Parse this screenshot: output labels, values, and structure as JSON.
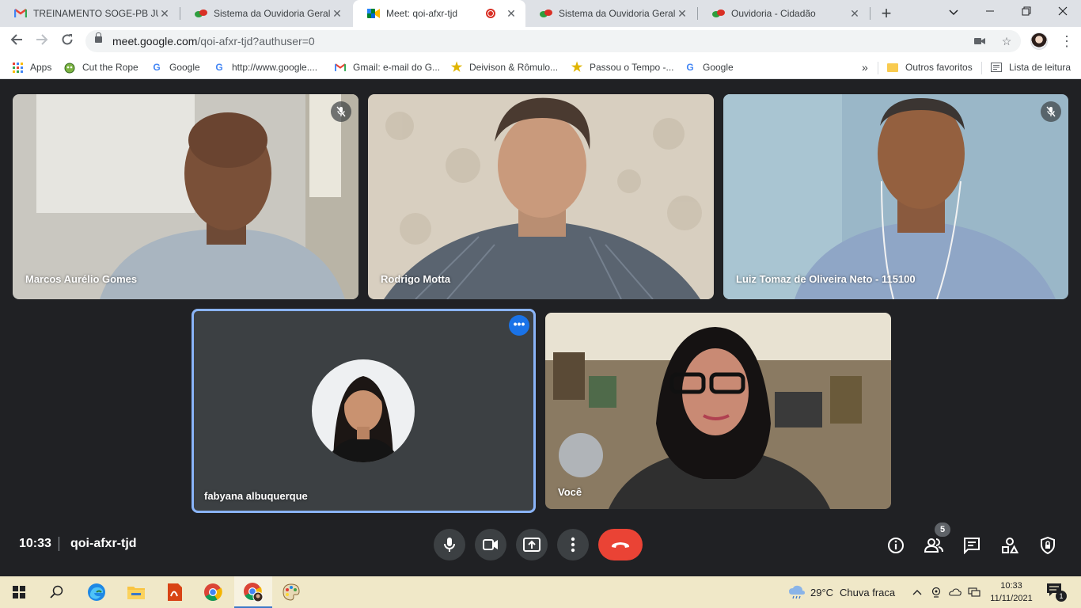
{
  "browser": {
    "tabs": [
      {
        "title": "TREINAMENTO SOGE-PB JUL",
        "icon": "gmail-icon"
      },
      {
        "title": "Sistema da Ouvidoria Geral d",
        "icon": "ouvidoria-icon"
      },
      {
        "title": "Meet: qoi-afxr-tjd",
        "icon": "meet-icon",
        "active": true
      },
      {
        "title": "Sistema da Ouvidoria Geral d",
        "icon": "ouvidoria-icon"
      },
      {
        "title": "Ouvidoria - Cidadão",
        "icon": "ouvidoria-icon"
      }
    ],
    "url_host": "meet.google.com",
    "url_path": "/qoi-afxr-tjd?authuser=0",
    "bookmarks": [
      {
        "label": "Apps",
        "icon": "apps-grid-icon"
      },
      {
        "label": "Cut the Rope",
        "icon": "cut-the-rope-icon"
      },
      {
        "label": "Google",
        "icon": "google-icon"
      },
      {
        "label": "http://www.google....",
        "icon": "google-icon"
      },
      {
        "label": "Gmail: e-mail do G...",
        "icon": "gmail-icon"
      },
      {
        "label": "Deivison & Rômulo...",
        "icon": "star-icon"
      },
      {
        "label": "Passou o Tempo -...",
        "icon": "star-icon"
      },
      {
        "label": "Google",
        "icon": "google-icon"
      }
    ],
    "overflow": "»",
    "other_favorites": "Outros favoritos",
    "reading_list": "Lista de leitura"
  },
  "meet": {
    "participants": [
      {
        "name": "Marcos Aurélio Gomes",
        "muted": true
      },
      {
        "name": "Rodrigo Motta",
        "muted": false
      },
      {
        "name": "Luiz Tomaz de Oliveira Neto - 115100",
        "muted": true
      },
      {
        "name": "fabyana albuquerque",
        "speaking": true
      },
      {
        "name": "Você"
      }
    ],
    "more_options": "•••",
    "time": "10:33",
    "meeting_code": "qoi-afxr-tjd",
    "people_count": "5"
  },
  "taskbar": {
    "weather": {
      "temp": "29°C",
      "condition": "Chuva fraca"
    },
    "time": "10:33",
    "date": "11/11/2021",
    "notifications": "1"
  },
  "colors": {
    "meet_bg": "#202124",
    "end_call": "#ea4335",
    "speaking_outline": "#8ab4f8",
    "accent": "#1a73e8"
  }
}
